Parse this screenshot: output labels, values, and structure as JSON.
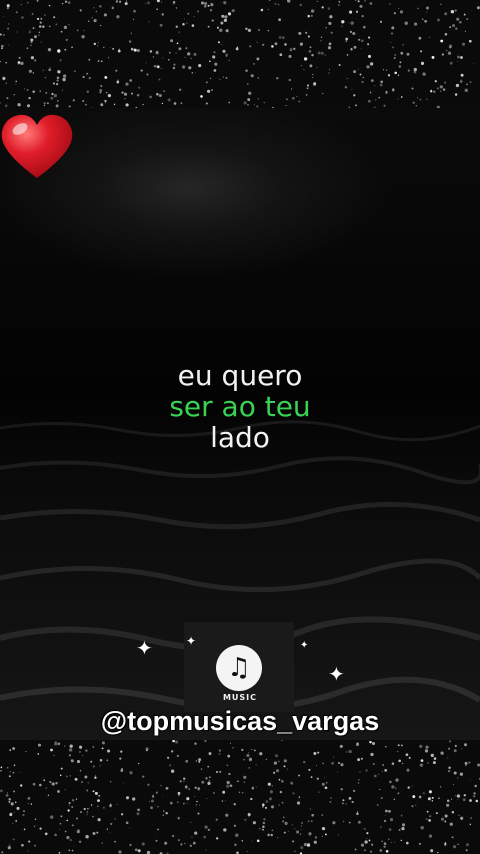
{
  "lyrics": {
    "line1": "eu quero",
    "line2": "ser ao teu",
    "line3": "lado"
  },
  "logo": {
    "icon": "music-notes-icon",
    "label": "MUSIC"
  },
  "handle": "@topmusicas_vargas",
  "colors": {
    "highlight": "#39d353",
    "text": "#f2f2f2",
    "heart": "#e01e2a"
  },
  "decor": {
    "heart_icon": "heart-icon"
  }
}
